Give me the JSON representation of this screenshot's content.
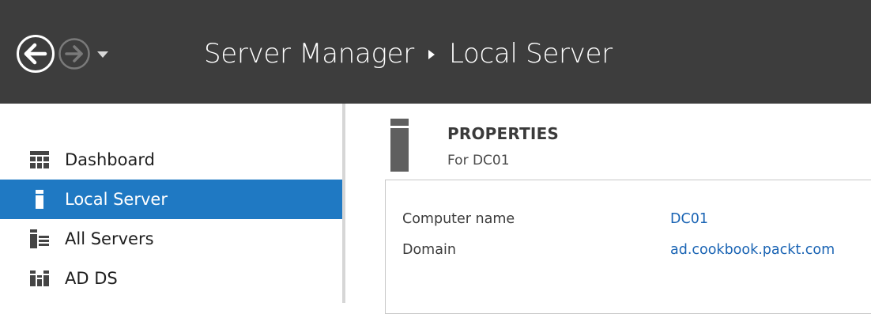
{
  "titlebar": {
    "breadcrumb": [
      "Server Manager",
      "Local Server"
    ],
    "background_color": "#3d3d3d",
    "nav": {
      "back_icon": "back-arrow-circle-icon",
      "forward_icon": "forward-arrow-circle-icon",
      "dropdown_icon": "caret-down-icon"
    }
  },
  "sidebar": {
    "accent_color": "#1f79c3",
    "items": [
      {
        "label": "Dashboard",
        "icon": "dashboard-grid-icon",
        "active": false
      },
      {
        "label": "Local Server",
        "icon": "server-icon",
        "active": true
      },
      {
        "label": "All Servers",
        "icon": "all-servers-icon",
        "active": false
      },
      {
        "label": "AD DS",
        "icon": "ad-ds-icon",
        "active": false
      }
    ]
  },
  "properties": {
    "title": "PROPERTIES",
    "subtitle": "For DC01",
    "icon": "server-tower-icon",
    "rows": [
      {
        "label": "Computer name",
        "value": "DC01"
      },
      {
        "label": "Domain",
        "value": "ad.cookbook.packt.com"
      }
    ],
    "link_color": "#1a64b4"
  }
}
